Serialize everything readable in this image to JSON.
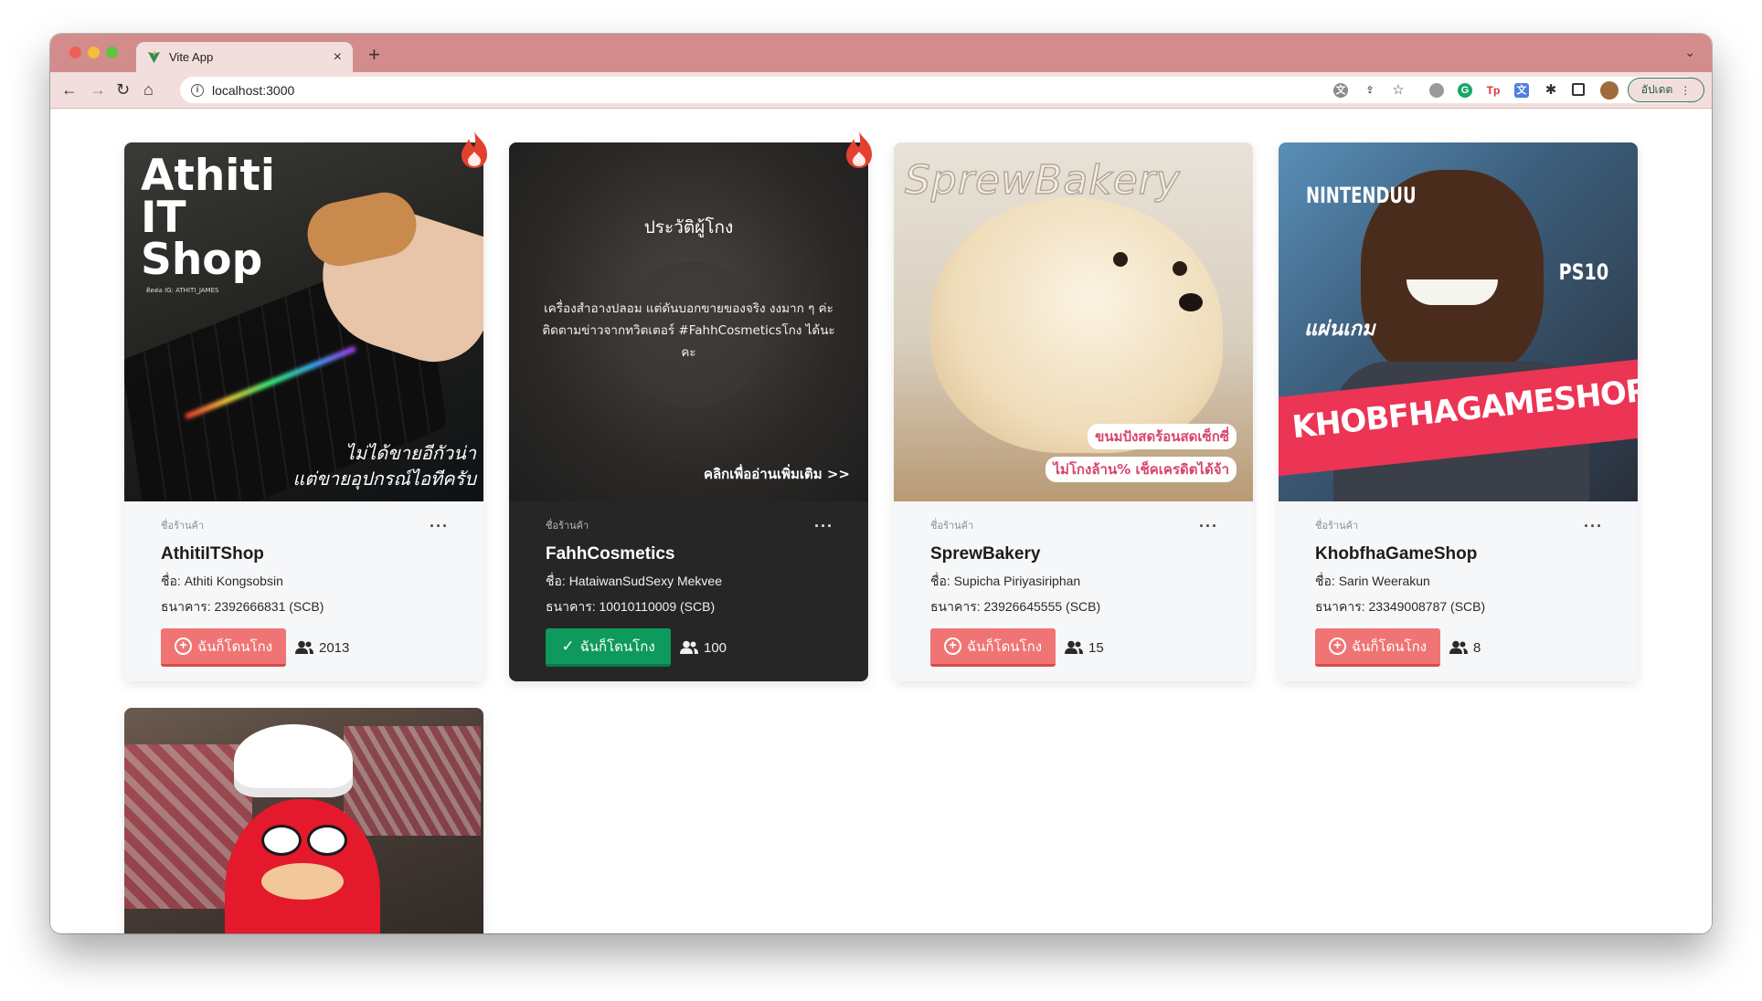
{
  "browser": {
    "tab_title": "Vite App",
    "tab_close": "×",
    "new_tab": "+",
    "url": "localhost:3000",
    "update_label": "อัปเดต",
    "more_label": "⋮"
  },
  "cards": [
    {
      "img_caption_title": "Athiti IT Shop",
      "img_caption_sub": "ติดต่อ IG: ATHITI_JAMES",
      "img_caption_bottom1": "ไม่ได้ขายอีกัวน่า",
      "img_caption_bottom2": "แต่ขายอุปกรณ์ไอทีครับ",
      "hot": true,
      "shop_label": "ชื่อร้านค้า",
      "shop_name": "AthitiITShop",
      "owner": "ชื่อ: Athiti Kongsobsin",
      "bank": "ธนาคาร: 2392666831 (SCB)",
      "button_label": "ฉันก็โดนโกง",
      "count": "2013",
      "dark": false
    },
    {
      "hot": true,
      "overlay_title": "ประวัติผู้โกง",
      "overlay_text": "เครื่องสำอางปลอม แต่ดันบอกขายของจริง งงมาก ๆ ค่ะ ติดตามข่าวจากทวิตเตอร์ #FahhCosmeticsโกง ได้นะคะ",
      "overlay_more": "คลิกเพื่ออ่านเพิ่มเติม >>",
      "shop_label": "ชื่อร้านค้า",
      "shop_name": "FahhCosmetics",
      "owner": "ชื่อ: HataiwanSudSexy Mekvee",
      "bank": "ธนาคาร: 10010110009 (SCB)",
      "button_label": "ฉันก็โดนโกง",
      "count": "100",
      "dark": true
    },
    {
      "img_caption_title": "SprewBakery",
      "img_caption_bottom1": "ขนมปังสดร้อนสดเซ็กซี่",
      "img_caption_bottom2": "ไม่โกงล้าน% เช็คเครดิตได้จ้า",
      "hot": false,
      "shop_label": "ชื่อร้านค้า",
      "shop_name": "SprewBakery",
      "owner": "ชื่อ: Supicha Piriyasiriphan",
      "bank": "ธนาคาร: 23926645555 (SCB)",
      "button_label": "ฉันก็โดนโกง",
      "count": "15",
      "dark": false
    },
    {
      "img_caption_title": "NINTENDUU",
      "img_caption_ps": "PS10",
      "img_caption_side": "แผ่นเกม",
      "img_caption_banner": "KHOBFHAGAMESHOP",
      "hot": false,
      "shop_label": "ชื่อร้านค้า",
      "shop_name": "KhobfhaGameShop",
      "owner": "ชื่อ: Sarin Weerakun",
      "bank": "ธนาคาร: 23349008787 (SCB)",
      "button_label": "ฉันก็โดนโกง",
      "count": "8",
      "dark": false
    }
  ],
  "more_dots": "···",
  "colors": {
    "accent_red": "#f07474",
    "accent_green": "#0d9a5c",
    "titlebar": "#d38c8c",
    "toolbar": "#f3dede"
  }
}
